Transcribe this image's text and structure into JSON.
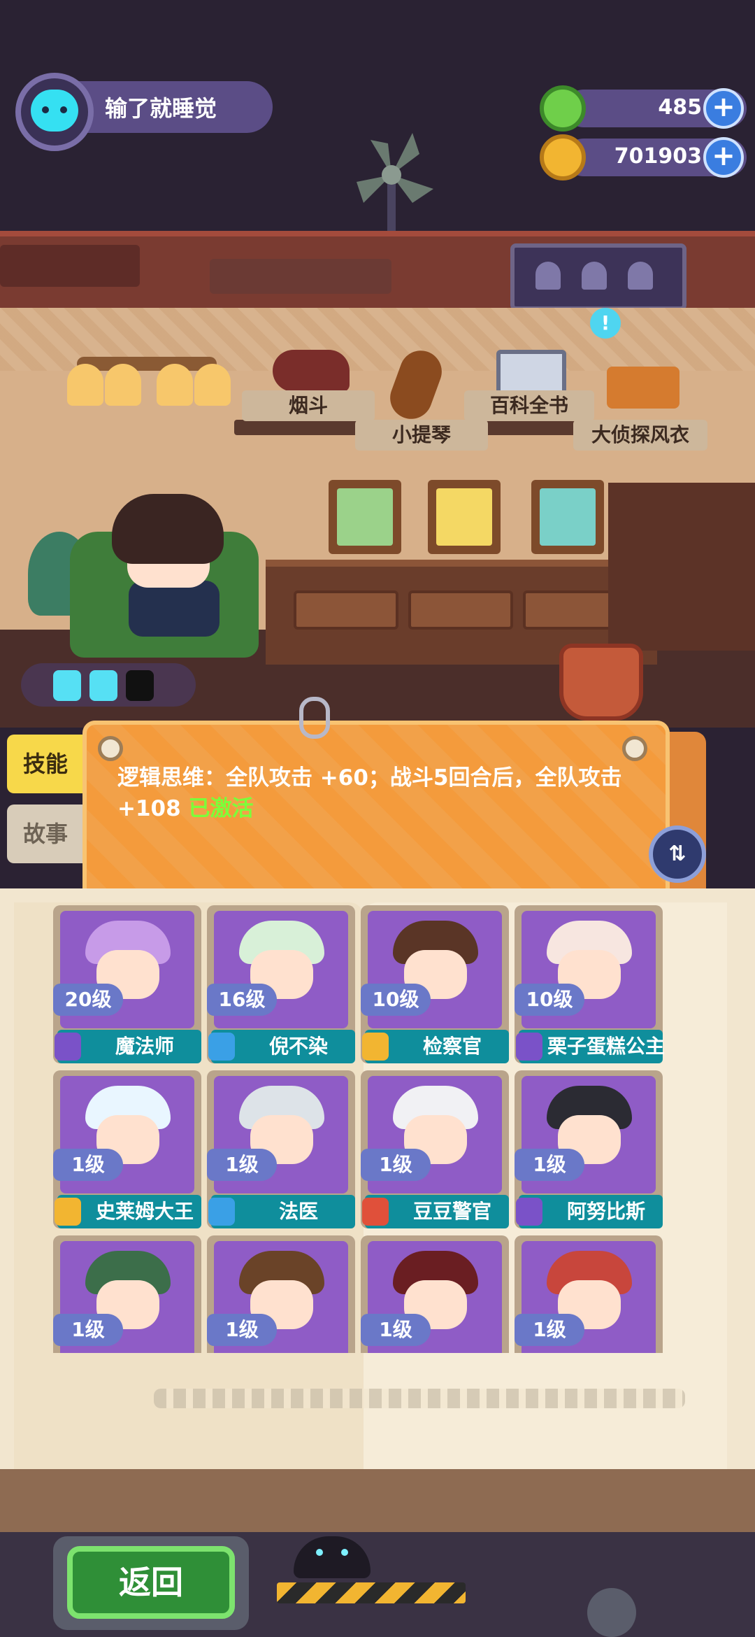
{
  "player": {
    "name": "输了就睡觉"
  },
  "currency": [
    {
      "name": "gem",
      "value": "485",
      "icon_color": "#6fcf4a"
    },
    {
      "name": "coin",
      "value": "701903",
      "icon_color": "#f2b531"
    }
  ],
  "items": [
    {
      "label": "烟斗"
    },
    {
      "label": "小提琴"
    },
    {
      "label": "百科全书"
    },
    {
      "label": "大侦探风衣"
    }
  ],
  "tabs": {
    "skill": "技能",
    "story": "故事"
  },
  "skill": {
    "text": "逻辑思维：全队攻击 +60；战斗5回合后，全队攻击 +108",
    "status": "已激活"
  },
  "characters": [
    {
      "level": "20级",
      "name": "魔法师",
      "type_color": "#7a52c8",
      "art": "#8f5cc6",
      "hat": "#c79be8"
    },
    {
      "level": "16级",
      "name": "倪不染",
      "type_color": "#3aa0e6",
      "art": "#8f5cc6",
      "hat": "#d8f0d8"
    },
    {
      "level": "10级",
      "name": "检察官",
      "type_color": "#f2b531",
      "art": "#8f5cc6",
      "hat": "#5a3526"
    },
    {
      "level": "10级",
      "name": "栗子蛋糕公主",
      "type_color": "#7a52c8",
      "art": "#8f5cc6",
      "hat": "#f7e6e0"
    },
    {
      "level": "1级",
      "name": "史莱姆大王",
      "type_color": "#f2b531",
      "art": "#8f5cc6",
      "hat": "#e9f6ff"
    },
    {
      "level": "1级",
      "name": "法医",
      "type_color": "#3aa0e6",
      "art": "#8f5cc6",
      "hat": "#dde3e8"
    },
    {
      "level": "1级",
      "name": "豆豆警官",
      "type_color": "#e0503a",
      "art": "#8f5cc6",
      "hat": "#f1f1f4"
    },
    {
      "level": "1级",
      "name": "阿努比斯",
      "type_color": "#7a52c8",
      "art": "#8f5cc6",
      "hat": "#2b2b33"
    },
    {
      "level": "1级",
      "name": "",
      "type_color": "#f2b531",
      "art": "#8f5cc6",
      "hat": "#3c6e4a"
    },
    {
      "level": "1级",
      "name": "",
      "type_color": "#e0503a",
      "art": "#8f5cc6",
      "hat": "#6a4328"
    },
    {
      "level": "1级",
      "name": "",
      "type_color": "#3aa0e6",
      "art": "#8f5cc6",
      "hat": "#6a1e22"
    },
    {
      "level": "1级",
      "name": "",
      "type_color": "#e0503a",
      "art": "#8f5cc6",
      "hat": "#c8463c"
    }
  ],
  "footer": {
    "back": "返回"
  },
  "colors": {
    "panel": "#f49b3c",
    "active": "#7cff3a",
    "name_bar": "#0f8e9c"
  }
}
